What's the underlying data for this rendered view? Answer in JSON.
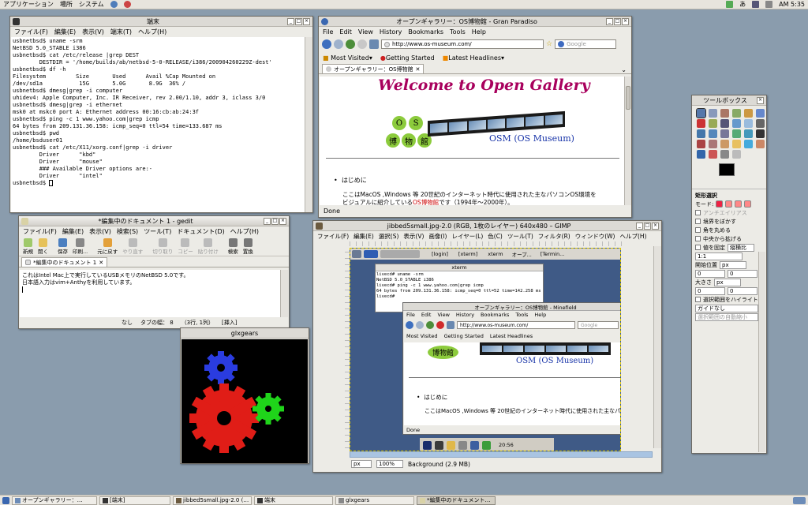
{
  "panel": {
    "menus": [
      "アプリケーション",
      "場所",
      "システム"
    ],
    "ime": "あ",
    "clock": "AM 5:35"
  },
  "taskbar": [
    {
      "label": "オープンギャラリー：…"
    },
    {
      "label": "[端末]"
    },
    {
      "label": "jibbed5small.jpg-2.0 (…"
    },
    {
      "label": "端末"
    },
    {
      "label": "glxgears"
    },
    {
      "label": "*編集中のドキュメント…"
    }
  ],
  "terminal": {
    "title": "端末",
    "menus": [
      "ファイル(F)",
      "編集(E)",
      "表示(V)",
      "端末(T)",
      "ヘルプ(H)"
    ],
    "lines": [
      "usbnetbsd$ uname -srm",
      "NetBSD 5.0_STABLE i386",
      "usbnetbsd$ cat /etc/release |grep DEST",
      "        DESTDIR = '/home/builds/ab/netbsd-5-0-RELEASE/i386/200904260229Z-dest'",
      "usbnetbsd$ df -h",
      "Filesystem         Size       Used      Avail %Cap Mounted on",
      "/dev/sd1a           15G       5.0G       8.9G  36% /",
      "usbnetbsd$ dmesg|grep -i computer",
      "uhidev4: Apple Computer, Inc. IR Receiver, rev 2.00/1.10, addr 3, iclass 3/0",
      "usbnetbsd$ dmesg|grep -i ethernet",
      "msk0 at mskc0 port A: Ethernet address 00:16:cb:ab:24:3f",
      "usbnetbsd$ ping -c 1 www.yahoo.com|grep icmp",
      "64 bytes from 209.131.36.158: icmp_seq=0 ttl=54 time=133.687 ms",
      "usbnetbsd$ pwd",
      "/home/bsduser01",
      "usbnetbsd$ cat /etc/X11/xorg.conf|grep -i driver",
      "        Driver      \"kbd\"",
      "        Driver      \"mouse\"",
      "        ### Available Driver options are:-",
      "        Driver      \"intel\"",
      "usbnetbsd$ "
    ]
  },
  "browser": {
    "title": "オープンギャラリー：OS博物館 - Gran Paradiso",
    "menus": [
      "File",
      "Edit",
      "View",
      "History",
      "Bookmarks",
      "Tools",
      "Help"
    ],
    "url": "http://www.os-museum.com/",
    "search_placeholder": "Google",
    "bookmarks": [
      "Most Visited",
      "Getting Started",
      "Latest Headlines"
    ],
    "tab": "オープンギャラリー：OS博物館",
    "banner": "Welcome to Open Gallery",
    "os_chars": [
      "O",
      "S"
    ],
    "museum_chars": [
      "博",
      "物",
      "館"
    ],
    "osm": "OSM (OS Museum)",
    "bullet": "はじめに",
    "para1": "ここはMacOS ,Windows 等 20世紀のインターネット時代に使用された主なパソコンOS環境を",
    "para2a": "ビジュアルに紹介している",
    "para2link": "OS博物館",
    "para2b": "です（1994年～2000年）。",
    "status": "Done"
  },
  "gedit": {
    "title": "*編集中のドキュメント 1 - gedit",
    "menus": [
      "ファイル(F)",
      "編集(E)",
      "表示(V)",
      "検索(S)",
      "ツール(T)",
      "ドキュメント(D)",
      "ヘルプ(H)"
    ],
    "toolbar": [
      "新規",
      "開く",
      "保存",
      "印刷...",
      "元に戻す",
      "やり直す",
      "切り取り",
      "コピー",
      "貼り付け",
      "検索",
      "置換"
    ],
    "tab": "*編集中のドキュメント 1",
    "lines": [
      "これはIntel Mac上で実行しているUSBメモリのNetBSD 5.0です。",
      "日本語入力はvim+Anthyを利用しています。"
    ],
    "status": {
      "highlight": "なし",
      "tab": "タブの幅：  8",
      "pos": "（3行, 1列）",
      "mode": "[挿入]"
    }
  },
  "glxgears": {
    "title": "glxgears"
  },
  "gimp": {
    "title": "jibbed5small.jpg-2.0 (RGB, 1枚のレイヤー) 640x480 – GIMP",
    "menus": [
      "ファイル(F)",
      "編集(E)",
      "選択(S)",
      "表示(V)",
      "画像(I)",
      "レイヤー(L)",
      "色(C)",
      "ツール(T)",
      "フィルタ(R)",
      "ウィンドウ(W)",
      "ヘルプ(H)"
    ],
    "unit": "px",
    "zoom": "100%",
    "status": "Background (2.9 MB)",
    "inner": {
      "tasks": [
        "[login]",
        "[xterm]",
        "xterm",
        "オープ...",
        "[Termin..."
      ],
      "xterm_title": "xterm",
      "xterm_lines": [
        "livecd# uname -srm",
        "NetBSD 5.0_STABLE i386",
        "livecd# ping -c 1 www.yahoo.com|grep icmp",
        "64 bytes from 209.131.36.158: icmp_seq=0 ttl=52 time=142.258 ms",
        "livecd# "
      ],
      "mf_title": "オープンギャラリー：OS博物館 - Minefield",
      "mf_menus": [
        "File",
        "Edit",
        "View",
        "History",
        "Bookmarks",
        "Tools",
        "Help"
      ],
      "mf_url": "http://www.os-museum.com/",
      "mf_search": "Google",
      "mf_bookmarks": [
        "Most Visited",
        "Getting Started",
        "Latest Headlines"
      ],
      "mf_museum": "博物館",
      "mf_osm": "OSM (OS Museum)",
      "mf_bullet": "はじめに",
      "mf_para": "ここはMacOS ,Windows 等 20世紀のインターネット時代に使用された主なパ",
      "mf_status": "Done",
      "dock_time": "20:56"
    }
  },
  "toolbox": {
    "title": "ツールボックス",
    "section": "矩形選択",
    "mode_label": "モード:",
    "options": [
      "アンチエイリアス",
      "境界をぼかす",
      "角を丸める",
      "中央から拡げる"
    ],
    "fixed_label": "値を固定",
    "fixed_value": "縦横比",
    "ratio": "1:1",
    "pos_label": "開始位置",
    "size_label": "大きさ",
    "unit": "px",
    "zero": "0",
    "highlight": "選択範囲をハイライト表示",
    "guide": "ガイドなし",
    "auto_shrink": "選択範囲の自動縮小"
  }
}
